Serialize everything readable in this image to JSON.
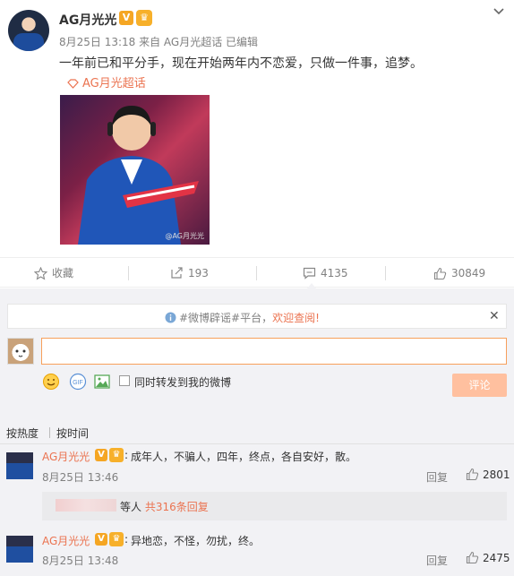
{
  "post": {
    "username": "AG月光光",
    "v_badge": "V",
    "meta": "8月25日 13:18 来自 AG月光超话  已编辑",
    "content": "一年前已和平分手，现在开始两年内不恋爱，只做一件事，追梦。",
    "topic": "AG月光超话",
    "photo_watermark": "@AG月光光"
  },
  "actions": {
    "favorite": "收藏",
    "repost": "193",
    "comment": "4135",
    "like": "30849"
  },
  "notice": {
    "prefix": "#微博辟谣#平台，",
    "highlight": "欢迎查阅!"
  },
  "composer": {
    "input_value": "",
    "forward_label": "同时转发到我的微博",
    "submit_label": "评论",
    "gif_label": "GIF"
  },
  "sort": {
    "hot": "按热度",
    "time": "按时间"
  },
  "comments": [
    {
      "name": "AG月光光",
      "text": "成年人，不骗人，四年，终点，各自安好，散。",
      "time": "8月25日 13:46",
      "reply_label": "回复",
      "likes": "2801"
    },
    {
      "name": "AG月光光",
      "text": "异地恋，不怪，勿扰，终。",
      "time": "8月25日 13:48",
      "reply_label": "回复",
      "likes": "2475"
    }
  ],
  "reply_summary": {
    "prefix": "等人 ",
    "highlight": "共316条回复"
  },
  "colors": {
    "accent": "#eb7350",
    "input_border": "#f7a05b",
    "submit_bg": "#ffc09f",
    "gray_text": "#808080"
  }
}
